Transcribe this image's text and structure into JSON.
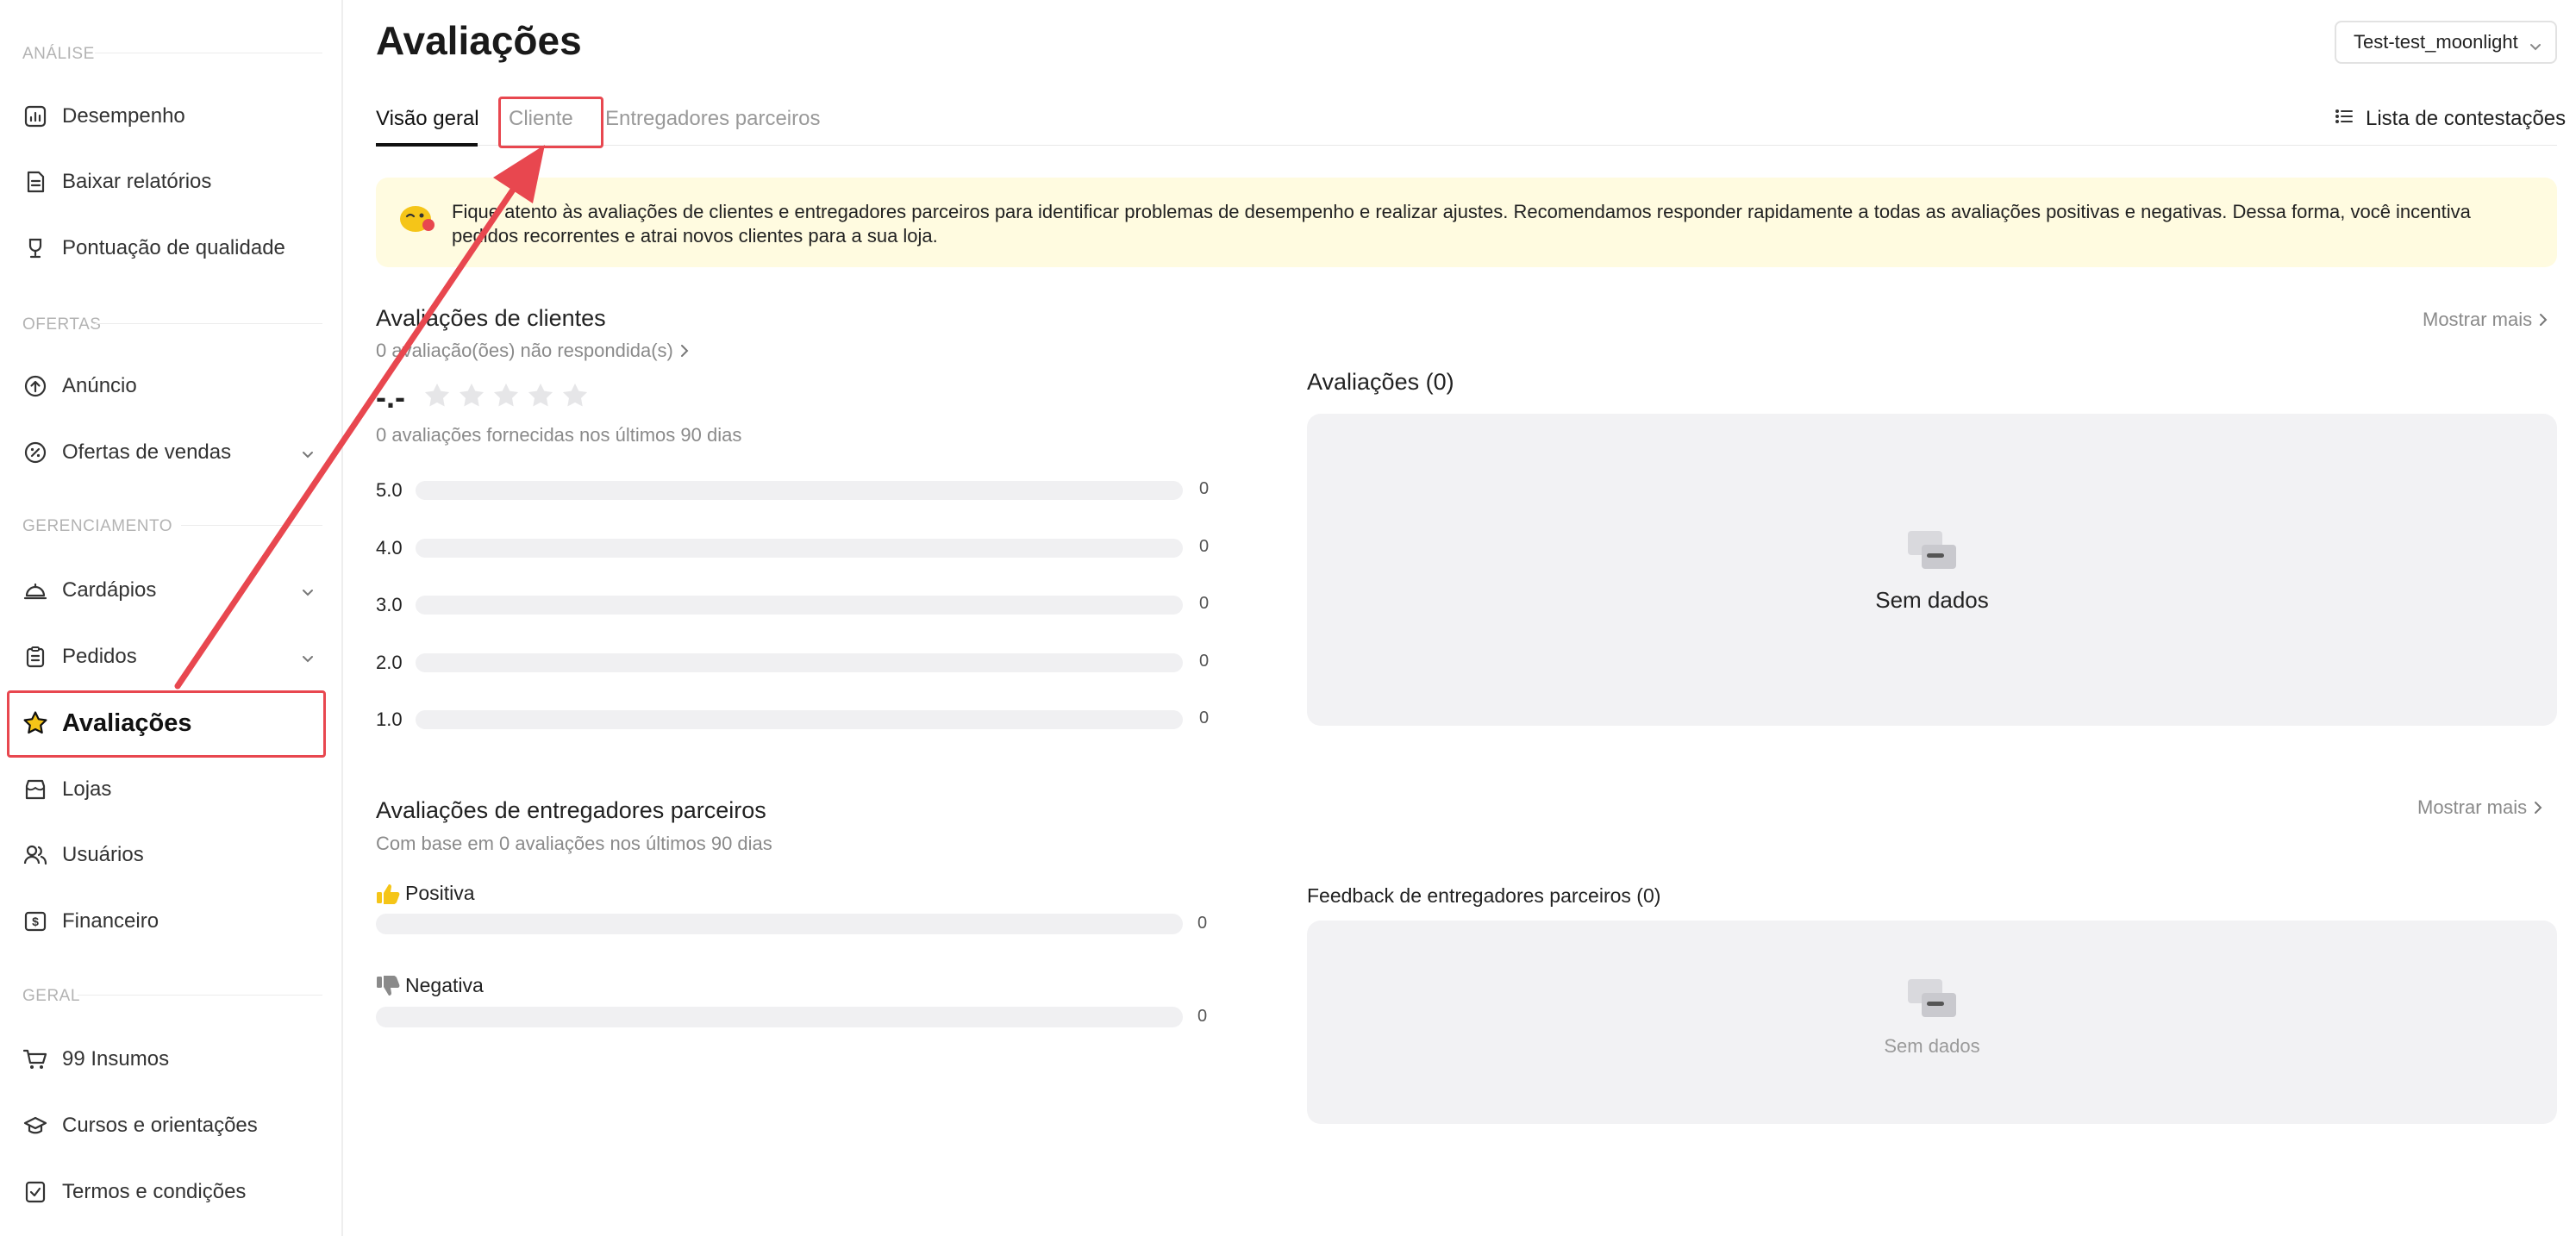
{
  "sidebar": {
    "sections": [
      {
        "title": "ANÁLISE"
      },
      {
        "title": "OFERTAS"
      },
      {
        "title": "GERENCIAMENTO"
      },
      {
        "title": "GERAL"
      }
    ],
    "items": [
      {
        "label": "Desempenho",
        "icon": "chart-icon"
      },
      {
        "label": "Baixar relatórios",
        "icon": "report-icon"
      },
      {
        "label": "Pontuação de qualidade",
        "icon": "trophy-icon"
      },
      {
        "label": "Anúncio",
        "icon": "arrow-up-circle-icon"
      },
      {
        "label": "Ofertas de vendas",
        "icon": "discount-icon"
      },
      {
        "label": "Cardápios",
        "icon": "cloche-icon"
      },
      {
        "label": "Pedidos",
        "icon": "clipboard-icon"
      },
      {
        "label": "Avaliações",
        "icon": "star-icon"
      },
      {
        "label": "Lojas",
        "icon": "store-icon"
      },
      {
        "label": "Usuários",
        "icon": "users-icon"
      },
      {
        "label": "Financeiro",
        "icon": "money-icon"
      },
      {
        "label": "99 Insumos",
        "icon": "cart-icon"
      },
      {
        "label": "Cursos e orientações",
        "icon": "graduation-cap-icon"
      },
      {
        "label": "Termos e condições",
        "icon": "document-check-icon"
      }
    ]
  },
  "header": {
    "title": "Avaliações",
    "store_select": "Test-test_moonlight"
  },
  "tabs": [
    {
      "label": "Visão geral"
    },
    {
      "label": "Cliente"
    },
    {
      "label": "Entregadores parceiros"
    }
  ],
  "disputes_label": "Lista de contestações",
  "banner": {
    "text": "Fique atento às avaliações de clientes e entregadores parceiros para identificar problemas de desempenho e realizar ajustes. Recomendamos responder rapidamente a todas as avaliações positivas e negativas. Dessa forma, você incentiva pedidos recorrentes e atrai novos clientes para a sua loja."
  },
  "customer": {
    "title": "Avaliações de clientes",
    "unanswered": "0 avaliação(ões) não respondida(s)",
    "more": "Mostrar mais",
    "rating": "-.-",
    "stars_filled": 0,
    "stars_total": 5,
    "summary": "0 avaliações fornecidas nos últimos 90 dias",
    "bars": [
      {
        "label": "5.0",
        "count": "0",
        "fraction": 0
      },
      {
        "label": "4.0",
        "count": "0",
        "fraction": 0
      },
      {
        "label": "3.0",
        "count": "0",
        "fraction": 0
      },
      {
        "label": "2.0",
        "count": "0",
        "fraction": 0
      },
      {
        "label": "1.0",
        "count": "0",
        "fraction": 0
      }
    ],
    "reviews_title": "Avaliações (0)",
    "empty_text": "Sem dados"
  },
  "couriers": {
    "title": "Avaliações de entregadores parceiros",
    "subtitle": "Com base em 0 avaliações nos últimos 90 dias",
    "more": "Mostrar mais",
    "positive_label": "Positiva",
    "positive_count": "0",
    "positive_fraction": 0,
    "negative_label": "Negativa",
    "negative_count": "0",
    "negative_fraction": 0,
    "feedback_title": "Feedback de entregadores parceiros (0)",
    "empty_text": "Sem dados"
  },
  "colors": {
    "accent": "#f5c518",
    "annotation": "#e8474f",
    "banner_bg": "#fffbe0"
  }
}
